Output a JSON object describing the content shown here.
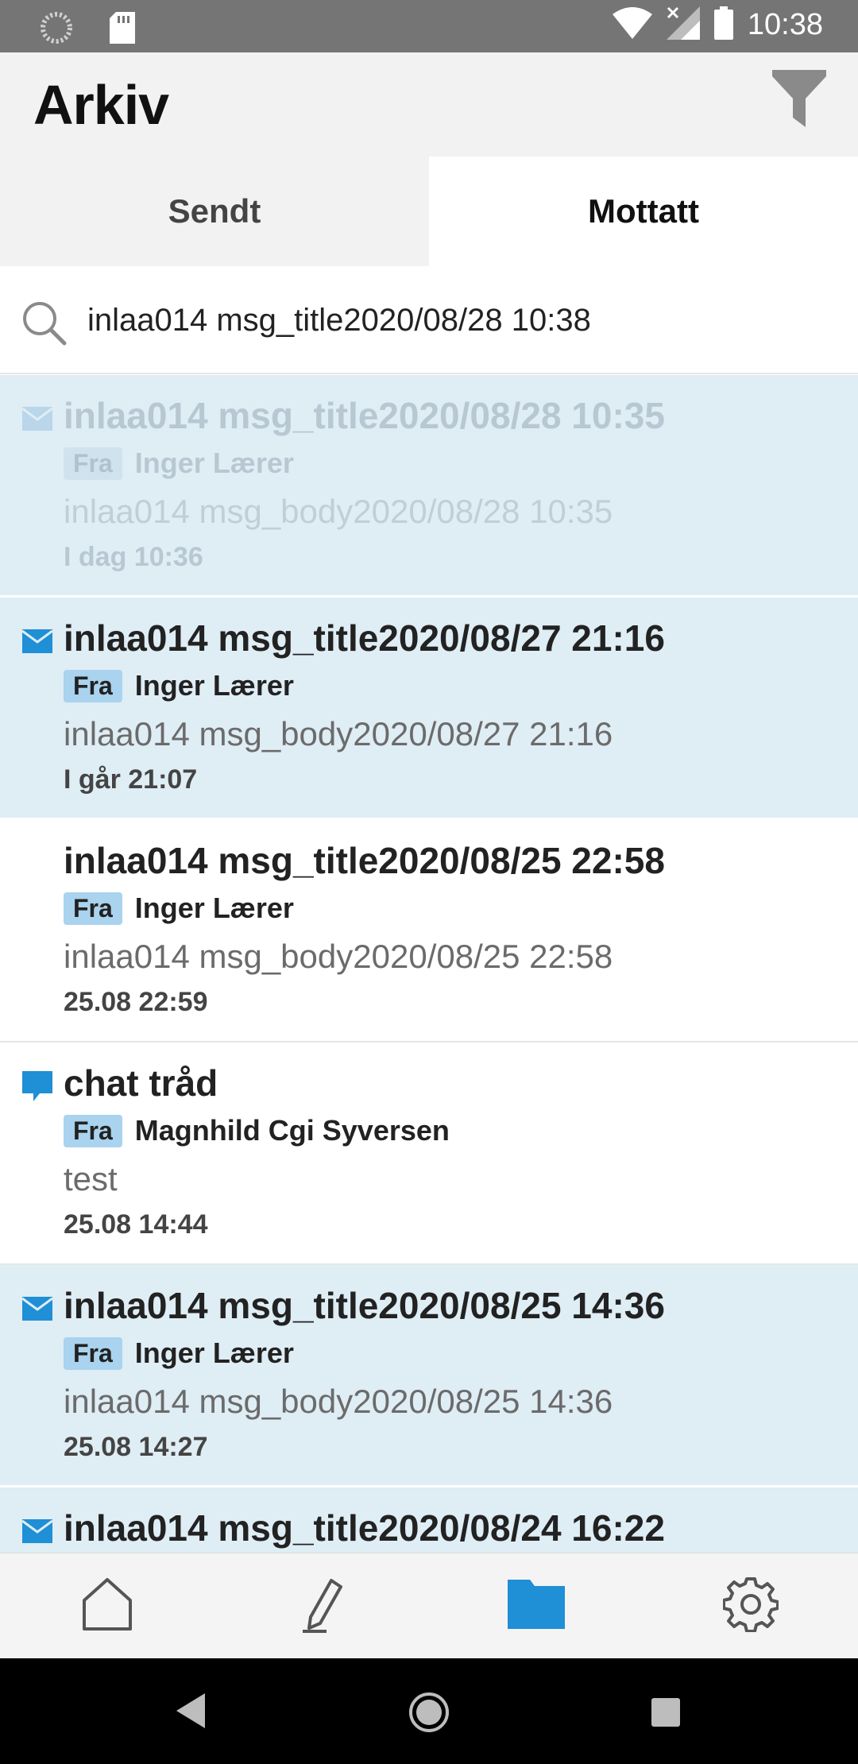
{
  "status_bar": {
    "time": "10:38",
    "icons": [
      "sync-icon",
      "sd-card-icon",
      "wifi-icon",
      "signal-icon",
      "battery-icon"
    ]
  },
  "header": {
    "title": "Arkiv",
    "filter_icon": "filter-icon"
  },
  "tabs": [
    {
      "label": "Sendt",
      "active": false
    },
    {
      "label": "Mottatt",
      "active": true
    }
  ],
  "search": {
    "value": "inlaa014 msg_title2020/08/28 10:38",
    "icon": "search-icon"
  },
  "messages": [
    {
      "subject": "inlaa014 msg_title2020/08/28 10:35",
      "from_label": "Fra",
      "sender": "Inger Lærer",
      "body": "inlaa014 msg_body2020/08/28 10:35",
      "date": "I dag 10:36",
      "type": "mail",
      "unread": true,
      "dimmed": true
    },
    {
      "subject": "inlaa014 msg_title2020/08/27 21:16",
      "from_label": "Fra",
      "sender": "Inger Lærer",
      "body": "inlaa014 msg_body2020/08/27 21:16",
      "date": "I går 21:07",
      "type": "mail",
      "unread": true
    },
    {
      "subject": "inlaa014 msg_title2020/08/25 22:58",
      "from_label": "Fra",
      "sender": "Inger Lærer",
      "body": "inlaa014 msg_body2020/08/25 22:58",
      "date": "25.08 22:59",
      "type": "none",
      "unread": false
    },
    {
      "subject": "chat tråd",
      "from_label": "Fra",
      "sender": "Magnhild Cgi Syversen",
      "body": "test",
      "date": "25.08 14:44",
      "type": "chat",
      "unread": false
    },
    {
      "subject": "inlaa014 msg_title2020/08/25 14:36",
      "from_label": "Fra",
      "sender": "Inger Lærer",
      "body": "inlaa014 msg_body2020/08/25 14:36",
      "date": "25.08 14:27",
      "type": "mail",
      "unread": true
    },
    {
      "subject": "inlaa014 msg_title2020/08/24 16:22",
      "from_label": "",
      "sender": "",
      "body": "",
      "date": "",
      "type": "mail",
      "unread": true
    }
  ],
  "bottom_nav": [
    {
      "icon": "home-icon",
      "active": false
    },
    {
      "icon": "compose-icon",
      "active": false
    },
    {
      "icon": "folder-icon",
      "active": true
    },
    {
      "icon": "settings-icon",
      "active": false
    }
  ],
  "colors": {
    "accent": "#1f8fd6",
    "unread_bg": "#dfedf5",
    "badge_bg": "#a9d3ee",
    "status_bar": "#757575",
    "header_bg": "#f2f2f2"
  }
}
